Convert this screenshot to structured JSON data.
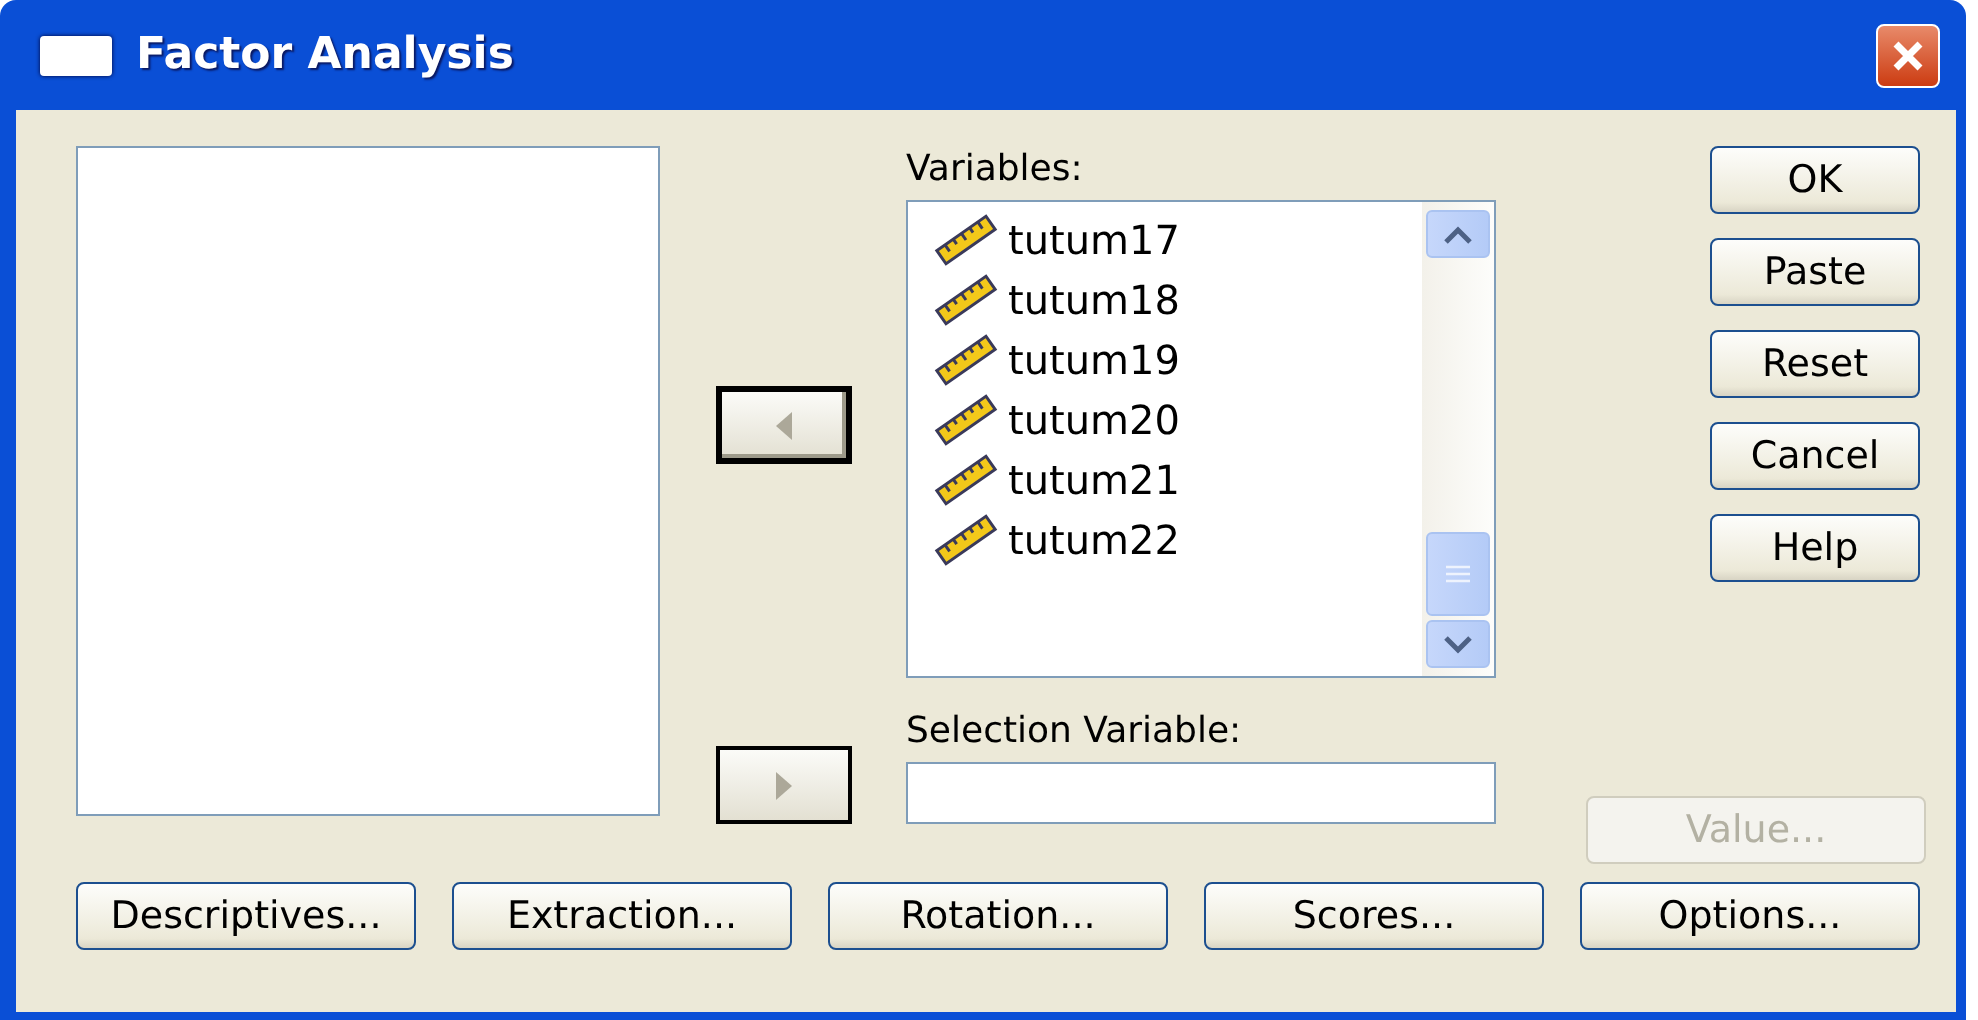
{
  "window": {
    "title": "Factor Analysis"
  },
  "arrow_buttons": [
    {
      "kind": "left",
      "focused": true
    },
    {
      "kind": "right",
      "focused": false
    }
  ],
  "variables": {
    "label": "Variables:",
    "items": [
      {
        "name": "tutum17"
      },
      {
        "name": "tutum18"
      },
      {
        "name": "tutum19"
      },
      {
        "name": "tutum20"
      },
      {
        "name": "tutum21"
      },
      {
        "name": "tutum22"
      }
    ]
  },
  "selection_variable": {
    "label": "Selection Variable:"
  },
  "side_buttons": [
    {
      "label": "OK",
      "disabled": false
    },
    {
      "label": "Paste",
      "disabled": false
    },
    {
      "label": "Reset",
      "disabled": false
    },
    {
      "label": "Cancel",
      "disabled": false
    },
    {
      "label": "Help",
      "disabled": false
    }
  ],
  "value_button": {
    "label": "Value...",
    "disabled": true
  },
  "bottom_buttons": [
    {
      "label": "Descriptives...",
      "disabled": false
    },
    {
      "label": "Extraction...",
      "disabled": false
    },
    {
      "label": "Rotation...",
      "disabled": false
    },
    {
      "label": "Scores...",
      "disabled": false
    },
    {
      "label": "Options...",
      "disabled": false
    }
  ]
}
